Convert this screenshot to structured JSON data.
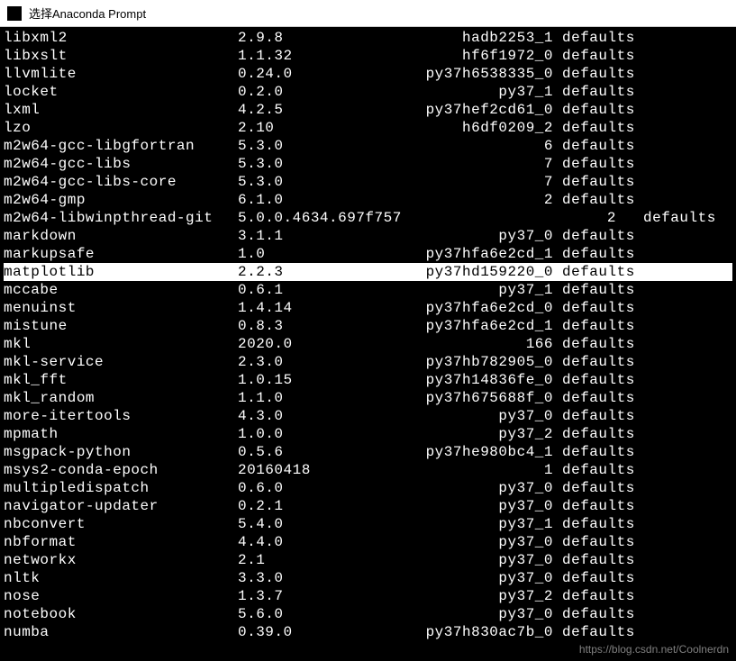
{
  "window": {
    "title": "选择Anaconda Prompt"
  },
  "packages": [
    {
      "name": "libxml2",
      "version": "2.9.8",
      "build": "hadb2253_1",
      "channel": "defaults"
    },
    {
      "name": "libxslt",
      "version": "1.1.32",
      "build": "hf6f1972_0",
      "channel": "defaults"
    },
    {
      "name": "llvmlite",
      "version": "0.24.0",
      "build": "py37h6538335_0",
      "channel": "defaults"
    },
    {
      "name": "locket",
      "version": "0.2.0",
      "build": "py37_1",
      "channel": "defaults"
    },
    {
      "name": "lxml",
      "version": "4.2.5",
      "build": "py37hef2cd61_0",
      "channel": "defaults"
    },
    {
      "name": "lzo",
      "version": "2.10",
      "build": "h6df0209_2",
      "channel": "defaults"
    },
    {
      "name": "m2w64-gcc-libgfortran",
      "version": "5.3.0",
      "build": "6",
      "channel": "defaults"
    },
    {
      "name": "m2w64-gcc-libs",
      "version": "5.3.0",
      "build": "7",
      "channel": "defaults"
    },
    {
      "name": "m2w64-gcc-libs-core",
      "version": "5.3.0",
      "build": "7",
      "channel": "defaults"
    },
    {
      "name": "m2w64-gmp",
      "version": "6.1.0",
      "build": "2",
      "channel": "defaults"
    },
    {
      "name": "m2w64-libwinpthread-git",
      "version": "5.0.0.4634.697f757",
      "build": "2",
      "channel": "defaults",
      "wide": true
    },
    {
      "name": "markdown",
      "version": "3.1.1",
      "build": "py37_0",
      "channel": "defaults"
    },
    {
      "name": "markupsafe",
      "version": "1.0",
      "build": "py37hfa6e2cd_1",
      "channel": "defaults"
    },
    {
      "name": "matplotlib",
      "version": "2.2.3",
      "build": "py37hd159220_0",
      "channel": "defaults",
      "selected": true
    },
    {
      "name": "mccabe",
      "version": "0.6.1",
      "build": "py37_1",
      "channel": "defaults"
    },
    {
      "name": "menuinst",
      "version": "1.4.14",
      "build": "py37hfa6e2cd_0",
      "channel": "defaults"
    },
    {
      "name": "mistune",
      "version": "0.8.3",
      "build": "py37hfa6e2cd_1",
      "channel": "defaults"
    },
    {
      "name": "mkl",
      "version": "2020.0",
      "build": "166",
      "channel": "defaults"
    },
    {
      "name": "mkl-service",
      "version": "2.3.0",
      "build": "py37hb782905_0",
      "channel": "defaults"
    },
    {
      "name": "mkl_fft",
      "version": "1.0.15",
      "build": "py37h14836fe_0",
      "channel": "defaults"
    },
    {
      "name": "mkl_random",
      "version": "1.1.0",
      "build": "py37h675688f_0",
      "channel": "defaults"
    },
    {
      "name": "more-itertools",
      "version": "4.3.0",
      "build": "py37_0",
      "channel": "defaults"
    },
    {
      "name": "mpmath",
      "version": "1.0.0",
      "build": "py37_2",
      "channel": "defaults"
    },
    {
      "name": "msgpack-python",
      "version": "0.5.6",
      "build": "py37he980bc4_1",
      "channel": "defaults"
    },
    {
      "name": "msys2-conda-epoch",
      "version": "20160418",
      "build": "1",
      "channel": "defaults"
    },
    {
      "name": "multipledispatch",
      "version": "0.6.0",
      "build": "py37_0",
      "channel": "defaults"
    },
    {
      "name": "navigator-updater",
      "version": "0.2.1",
      "build": "py37_0",
      "channel": "defaults"
    },
    {
      "name": "nbconvert",
      "version": "5.4.0",
      "build": "py37_1",
      "channel": "defaults"
    },
    {
      "name": "nbformat",
      "version": "4.4.0",
      "build": "py37_0",
      "channel": "defaults"
    },
    {
      "name": "networkx",
      "version": "2.1",
      "build": "py37_0",
      "channel": "defaults"
    },
    {
      "name": "nltk",
      "version": "3.3.0",
      "build": "py37_0",
      "channel": "defaults"
    },
    {
      "name": "nose",
      "version": "1.3.7",
      "build": "py37_2",
      "channel": "defaults"
    },
    {
      "name": "notebook",
      "version": "5.6.0",
      "build": "py37_0",
      "channel": "defaults"
    },
    {
      "name": "numba",
      "version": "0.39.0",
      "build": "py37h830ac7b_0",
      "channel": "defaults"
    }
  ],
  "watermark": "https://blog.csdn.net/Coolnerdn"
}
